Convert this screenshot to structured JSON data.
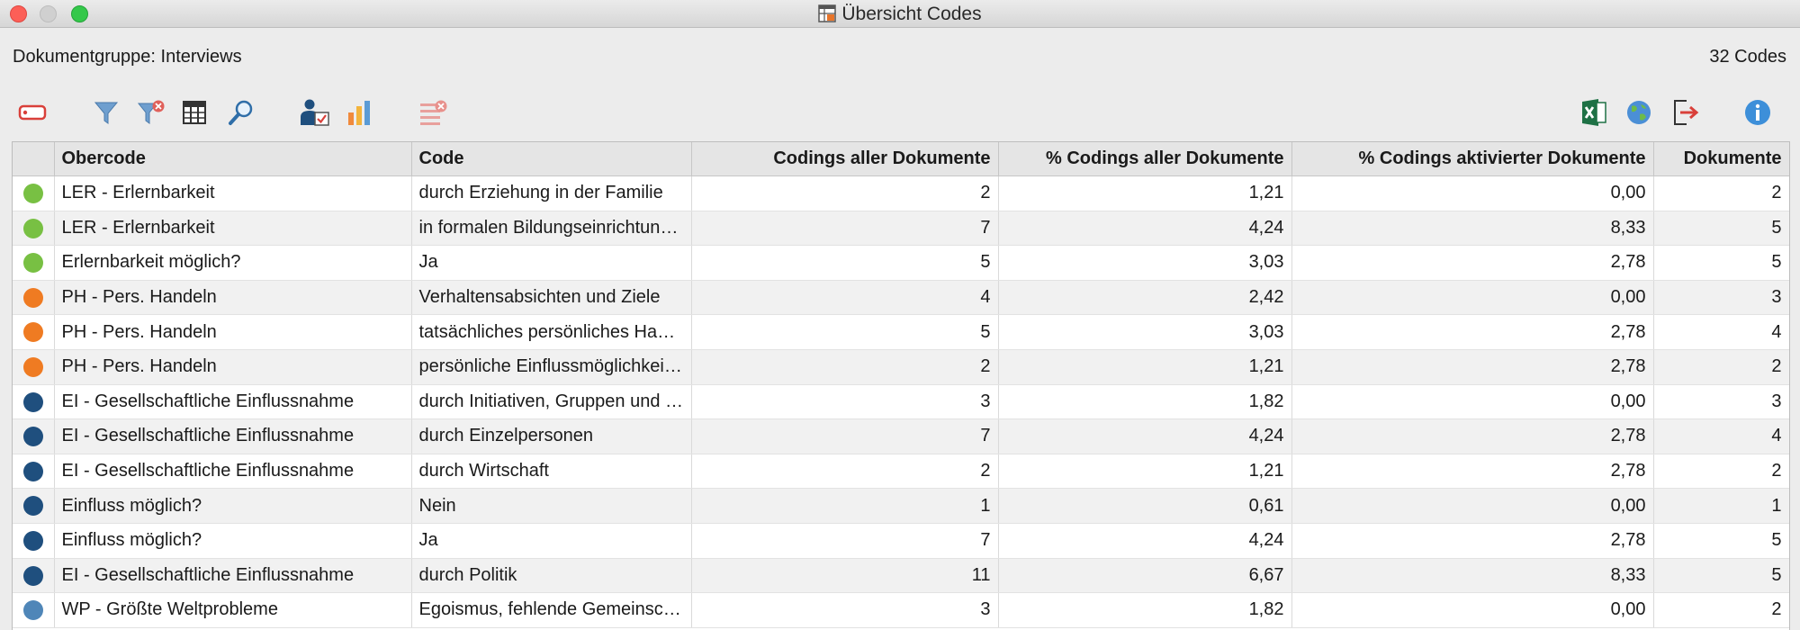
{
  "window": {
    "title": "Übersicht Codes"
  },
  "header": {
    "group_label": "Dokumentgruppe: Interviews",
    "count_label": "32 Codes"
  },
  "toolbar": {
    "left": [
      "tag-icon",
      "filter-icon",
      "filter-remove-icon",
      "table-columns-icon",
      "search-icon",
      "user-check-icon",
      "bar-chart-icon",
      "clear-list-icon"
    ],
    "right": [
      "excel-icon",
      "globe-icon",
      "export-icon",
      "info-icon"
    ]
  },
  "table": {
    "columns": [
      "",
      "Obercode",
      "Code",
      "Codings aller Dokumente",
      "% Codings aller Dokumente",
      "% Codings aktivierter Dokumente",
      "Dokumente"
    ],
    "rows": [
      {
        "color": "#78c043",
        "obercode": "LER - Erlernbarkeit",
        "code": "durch Erziehung in der Familie",
        "codings": "2",
        "pct_all": "1,21",
        "pct_active": "0,00",
        "docs": "2"
      },
      {
        "color": "#78c043",
        "obercode": "LER - Erlernbarkeit",
        "code": "in formalen Bildungseinrichtungen",
        "codings": "7",
        "pct_all": "4,24",
        "pct_active": "8,33",
        "docs": "5"
      },
      {
        "color": "#78c043",
        "obercode": "Erlernbarkeit möglich?",
        "code": "Ja",
        "codings": "5",
        "pct_all": "3,03",
        "pct_active": "2,78",
        "docs": "5"
      },
      {
        "color": "#ef7b22",
        "obercode": "PH - Pers. Handeln",
        "code": "Verhaltensabsichten und Ziele",
        "codings": "4",
        "pct_all": "2,42",
        "pct_active": "0,00",
        "docs": "3"
      },
      {
        "color": "#ef7b22",
        "obercode": "PH - Pers. Handeln",
        "code": "tatsächliches persönliches Handeln",
        "codings": "5",
        "pct_all": "3,03",
        "pct_active": "2,78",
        "docs": "4"
      },
      {
        "color": "#ef7b22",
        "obercode": "PH - Pers. Handeln",
        "code": "persönliche Einflussmöglichkeiten",
        "codings": "2",
        "pct_all": "1,21",
        "pct_active": "2,78",
        "docs": "2"
      },
      {
        "color": "#1f4f7e",
        "obercode": "EI - Gesellschaftliche Einflussnahme",
        "code": "durch Initiativen, Gruppen und Vereine",
        "codings": "3",
        "pct_all": "1,82",
        "pct_active": "0,00",
        "docs": "3"
      },
      {
        "color": "#1f4f7e",
        "obercode": "EI - Gesellschaftliche Einflussnahme",
        "code": "durch Einzelpersonen",
        "codings": "7",
        "pct_all": "4,24",
        "pct_active": "2,78",
        "docs": "4"
      },
      {
        "color": "#1f4f7e",
        "obercode": "EI - Gesellschaftliche Einflussnahme",
        "code": "durch Wirtschaft",
        "codings": "2",
        "pct_all": "1,21",
        "pct_active": "2,78",
        "docs": "2"
      },
      {
        "color": "#1f4f7e",
        "obercode": "Einfluss möglich?",
        "code": "Nein",
        "codings": "1",
        "pct_all": "0,61",
        "pct_active": "0,00",
        "docs": "1"
      },
      {
        "color": "#1f4f7e",
        "obercode": "Einfluss möglich?",
        "code": "Ja",
        "codings": "7",
        "pct_all": "4,24",
        "pct_active": "2,78",
        "docs": "5"
      },
      {
        "color": "#1f4f7e",
        "obercode": "EI - Gesellschaftliche Einflussnahme",
        "code": "durch Politik",
        "codings": "11",
        "pct_all": "6,67",
        "pct_active": "8,33",
        "docs": "5"
      },
      {
        "color": "#4f86b8",
        "obercode": "WP - Größte Weltprobleme",
        "code": "Egoismus, fehlende Gemeinschaft",
        "codings": "3",
        "pct_all": "1,82",
        "pct_active": "0,00",
        "docs": "2"
      }
    ]
  }
}
